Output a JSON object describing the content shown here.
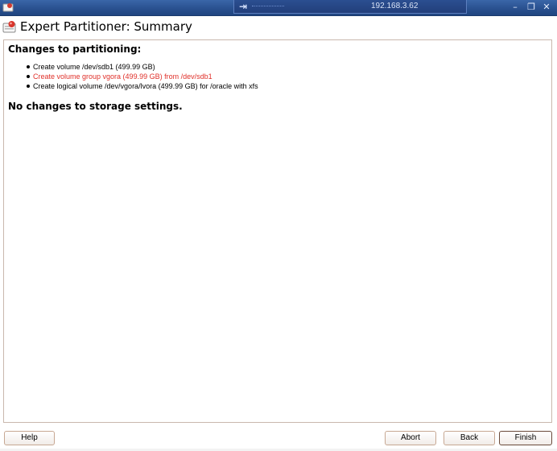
{
  "titlebar": {
    "remote_host": "192.168.3.62",
    "icons": [
      "app-menu-icon",
      "pin-icon",
      "minimize-icon",
      "restore-icon",
      "close-icon"
    ]
  },
  "header": {
    "title": "Expert Partitioner: Summary",
    "icon": "partitioner-icon"
  },
  "content": {
    "section1_title": "Changes to partitioning:",
    "changes": [
      "Create volume /dev/sdb1 (499.99 GB)",
      "Create volume group vgora (499.99 GB) from /dev/sdb1",
      "Create logical volume /dev/vgora/lvora (499.99 GB) for /oracle with xfs"
    ],
    "section2_title": "No changes to storage settings."
  },
  "buttons": {
    "help": "Help",
    "abort": "Abort",
    "back": "Back",
    "finish": "Finish"
  },
  "colors": {
    "titlebar": "#2a5190",
    "highlight_text": "#e0302a",
    "frame_border": "#c9b8ad"
  }
}
